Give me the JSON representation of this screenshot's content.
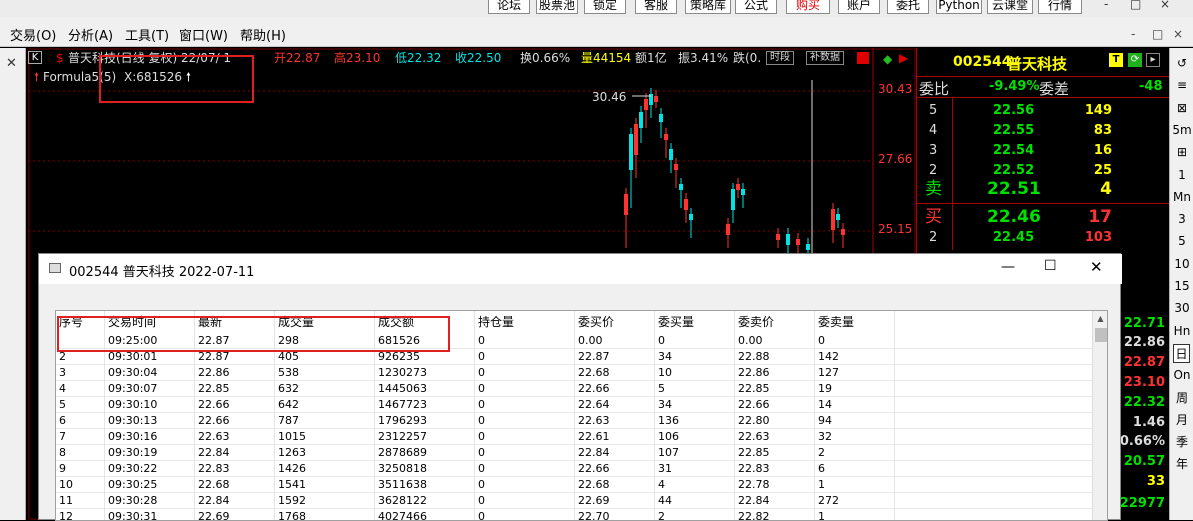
{
  "topbar": {
    "buttons": [
      "论坛",
      "股票池",
      "锁定",
      "客服",
      "策略库",
      "公式",
      "购买",
      "账户",
      "委托",
      "Python",
      "云课堂",
      "行情"
    ],
    "window_controls": [
      "-",
      "□",
      "×"
    ]
  },
  "menubar": {
    "items": [
      "交易(O)",
      "分析(A)",
      "工具(T)",
      "窗口(W)",
      "帮助(H)"
    ],
    "window_controls": [
      "-",
      "□",
      "×"
    ]
  },
  "chart": {
    "period_badge": "K",
    "stock_label": "普天科技(日线 复权) 22/07/ 1",
    "open": "开22.87",
    "high": "高23.10",
    "low": "低22.32",
    "close": "收22.50",
    "turnover": "换0.66%",
    "volume": "量44154",
    "amount": "额1亿",
    "amplitude": "振3.41%",
    "change": "跌(0.",
    "btn_period": "时段",
    "btn_supplement": "补数据",
    "formula_label": "Formula5(5)",
    "formula_value": "X:681526",
    "peak_label": "30.46",
    "price_axis": [
      "30.43",
      "27.66",
      "25.15"
    ],
    "colors": {
      "up": "#ff3232",
      "down": "#00e4e4",
      "volume": "#ffff00"
    }
  },
  "quote": {
    "code": "002544",
    "name": "普天科技",
    "weibi_label": "委比",
    "weibi_value": "-9.49%",
    "weicha_label": "委差",
    "weicha_value": "-48",
    "sell_levels": [
      {
        "level": "5",
        "price": "22.56",
        "vol": "149"
      },
      {
        "level": "4",
        "price": "22.55",
        "vol": "83"
      },
      {
        "level": "3",
        "price": "22.54",
        "vol": "16"
      },
      {
        "level": "2",
        "price": "22.52",
        "vol": "25"
      },
      {
        "level": "卖",
        "price": "22.51",
        "vol": "4"
      }
    ],
    "buy_levels": [
      {
        "level": "买",
        "price": "22.46",
        "vol": "17"
      },
      {
        "level": "2",
        "price": "22.45",
        "vol": "103"
      }
    ],
    "right_values": [
      "22.71",
      "22.86",
      "22.87",
      "23.10",
      "22.32",
      "1.46",
      "0.66%",
      "20.57",
      "33",
      "22977"
    ]
  },
  "right_toolbar": [
    "↺",
    "≡",
    "⊠",
    "5m",
    "⊞",
    "1",
    "Mn",
    "3",
    "5",
    "10",
    "15",
    "30",
    "Hn",
    "日",
    "On",
    "周",
    "月",
    "季",
    "年"
  ],
  "dialog": {
    "title": "002544 普天科技 2022-07-11",
    "controls": [
      "—",
      "☐",
      "✕"
    ],
    "columns": [
      "序号",
      "交易时间",
      "最新",
      "成交量",
      "成交额",
      "持仓量",
      "委买价",
      "委买量",
      "委卖价",
      "委卖量"
    ],
    "rows": [
      [
        "",
        "09:25:00",
        "22.87",
        "298",
        "681526",
        "0",
        "0.00",
        "0",
        "0.00",
        "0"
      ],
      [
        "2",
        "09:30:01",
        "22.87",
        "405",
        "926235",
        "0",
        "22.87",
        "34",
        "22.88",
        "142"
      ],
      [
        "3",
        "09:30:04",
        "22.86",
        "538",
        "1230273",
        "0",
        "22.68",
        "10",
        "22.86",
        "127"
      ],
      [
        "4",
        "09:30:07",
        "22.85",
        "632",
        "1445063",
        "0",
        "22.66",
        "5",
        "22.85",
        "19"
      ],
      [
        "5",
        "09:30:10",
        "22.66",
        "642",
        "1467723",
        "0",
        "22.64",
        "34",
        "22.66",
        "14"
      ],
      [
        "6",
        "09:30:13",
        "22.66",
        "787",
        "1796293",
        "0",
        "22.63",
        "136",
        "22.80",
        "94"
      ],
      [
        "7",
        "09:30:16",
        "22.63",
        "1015",
        "2312257",
        "0",
        "22.61",
        "106",
        "22.63",
        "32"
      ],
      [
        "8",
        "09:30:19",
        "22.84",
        "1263",
        "2878689",
        "0",
        "22.84",
        "107",
        "22.85",
        "2"
      ],
      [
        "9",
        "09:30:22",
        "22.83",
        "1426",
        "3250818",
        "0",
        "22.66",
        "31",
        "22.83",
        "6"
      ],
      [
        "10",
        "09:30:25",
        "22.68",
        "1541",
        "3511638",
        "0",
        "22.68",
        "4",
        "22.78",
        "1"
      ],
      [
        "11",
        "09:30:28",
        "22.84",
        "1592",
        "3628122",
        "0",
        "22.69",
        "44",
        "22.84",
        "272"
      ],
      [
        "12",
        "09:30:31",
        "22.69",
        "1768",
        "4027466",
        "0",
        "22.70",
        "2",
        "22.82",
        "1"
      ]
    ]
  }
}
